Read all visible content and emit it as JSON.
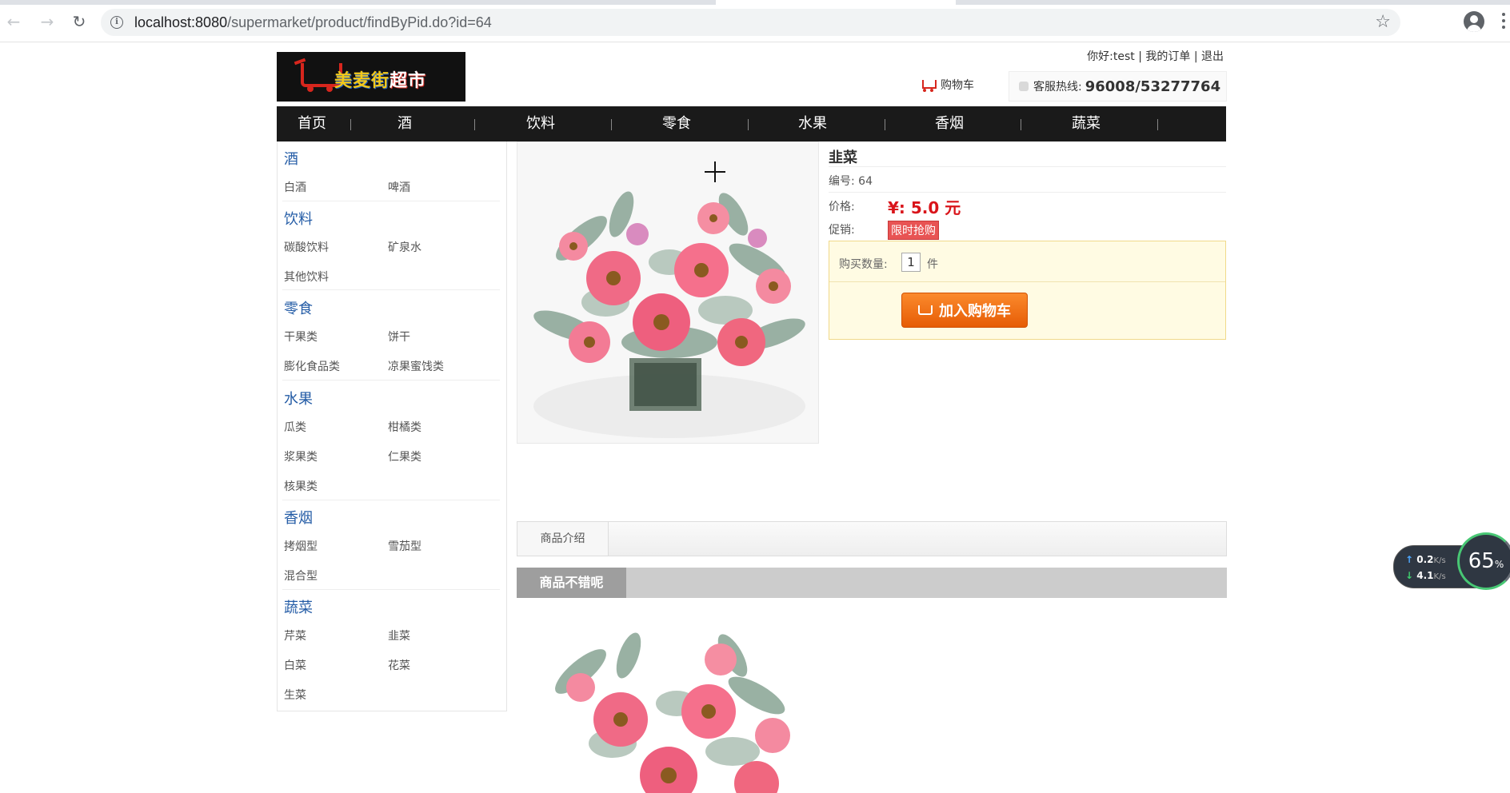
{
  "browser": {
    "url_host": "localhost:8080",
    "url_path": "/supermarket/product/findByPid.do?id=64"
  },
  "header": {
    "logo_text_yellow": "美麦街",
    "logo_text_white": "超市",
    "greeting": "你好:",
    "username": "test",
    "sep1": " | ",
    "my_orders": "我的订单",
    "sep2": " | ",
    "logout": "退出",
    "cart": "购物车",
    "hotline_label": "客服热线:",
    "hotline_number": "96008/53277764"
  },
  "nav": {
    "items": [
      "首页",
      "酒",
      "饮料",
      "零食",
      "水果",
      "香烟",
      "蔬菜"
    ]
  },
  "sidebar": {
    "categories": [
      {
        "name": "酒",
        "subs": [
          "白酒",
          "啤酒"
        ]
      },
      {
        "name": "饮料",
        "subs": [
          "碳酸饮料",
          "矿泉水",
          "其他饮料"
        ]
      },
      {
        "name": "零食",
        "subs": [
          "干果类",
          "饼干",
          "膨化食品类",
          "凉果蜜饯类"
        ]
      },
      {
        "name": "水果",
        "subs": [
          "瓜类",
          "柑橘类",
          "浆果类",
          "仁果类",
          "核果类"
        ]
      },
      {
        "name": "香烟",
        "subs": [
          "拷烟型",
          "雪茄型",
          "混合型"
        ]
      },
      {
        "name": "蔬菜",
        "subs": [
          "芹菜",
          "韭菜",
          "白菜",
          "花菜",
          "生菜"
        ]
      }
    ]
  },
  "product": {
    "name": "韭菜",
    "id_label": "编号:",
    "id": "64",
    "price_label": "价格:",
    "price": "¥: 5.0 元",
    "promo_label": "促销:",
    "promo": "限时抢购",
    "qty_label": "购买数量:",
    "qty_value": "1",
    "qty_unit": "件",
    "add_to_cart": "加入购物车"
  },
  "tabs": {
    "intro": "商品介绍"
  },
  "banner": {
    "tag": "商品不错呢"
  },
  "speed_widget": {
    "up": "0.2",
    "down": "4.1",
    "unit": "K/s",
    "percent": "65",
    "percent_sign": "%"
  },
  "colors": {
    "nav_bg": "#1a1a1a",
    "category_blue": "#245ca6",
    "price_red": "#d9141a",
    "button_orange": "#f07319"
  }
}
